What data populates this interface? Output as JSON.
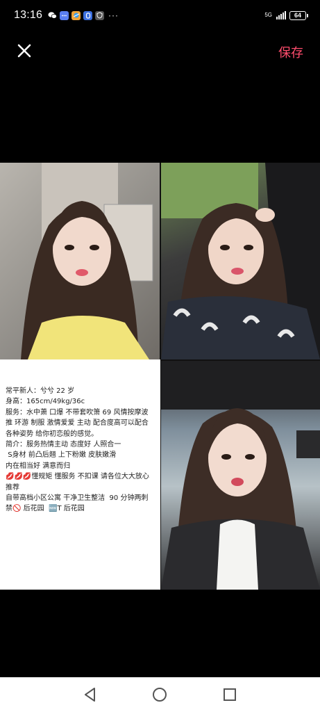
{
  "status_bar": {
    "time": "13:16",
    "network": "5G",
    "battery": "64"
  },
  "header": {
    "save_label": "保存"
  },
  "post": {
    "caption": "常平新人：兮兮 22 岁\n身高：165cm/49kg/36c\n服务：水中萧 口爆 不带套吹箫 69 风情按摩波推 环游 制服 激情爱爱 主动 配合度高可以配合各种姿势 给你初恋般的感觉。\n简介：服务热情主动 态度好 人照合一\n S身材 前凸后翘 上下粉嫩 皮肤嫩滑\n内在相当好 满意而归\n💋💋💋懂规矩 懂服务 不扣课 请各位大大放心推荐\n自带高档小区公寓 干净卫生整洁  90 分钟两刺禁🚫 后花园  🆕T 后花园"
  },
  "photos": [
    {
      "id": "photo-top-left"
    },
    {
      "id": "photo-top-right"
    },
    {
      "id": "photo-bottom-right"
    }
  ],
  "colors": {
    "background": "#000000",
    "accent": "#ff4d6d",
    "nav_bar": "#ffffff"
  },
  "icons": {
    "close": "close-icon",
    "back": "back-triangle-icon",
    "home": "home-circle-icon",
    "recents": "recents-square-icon"
  }
}
